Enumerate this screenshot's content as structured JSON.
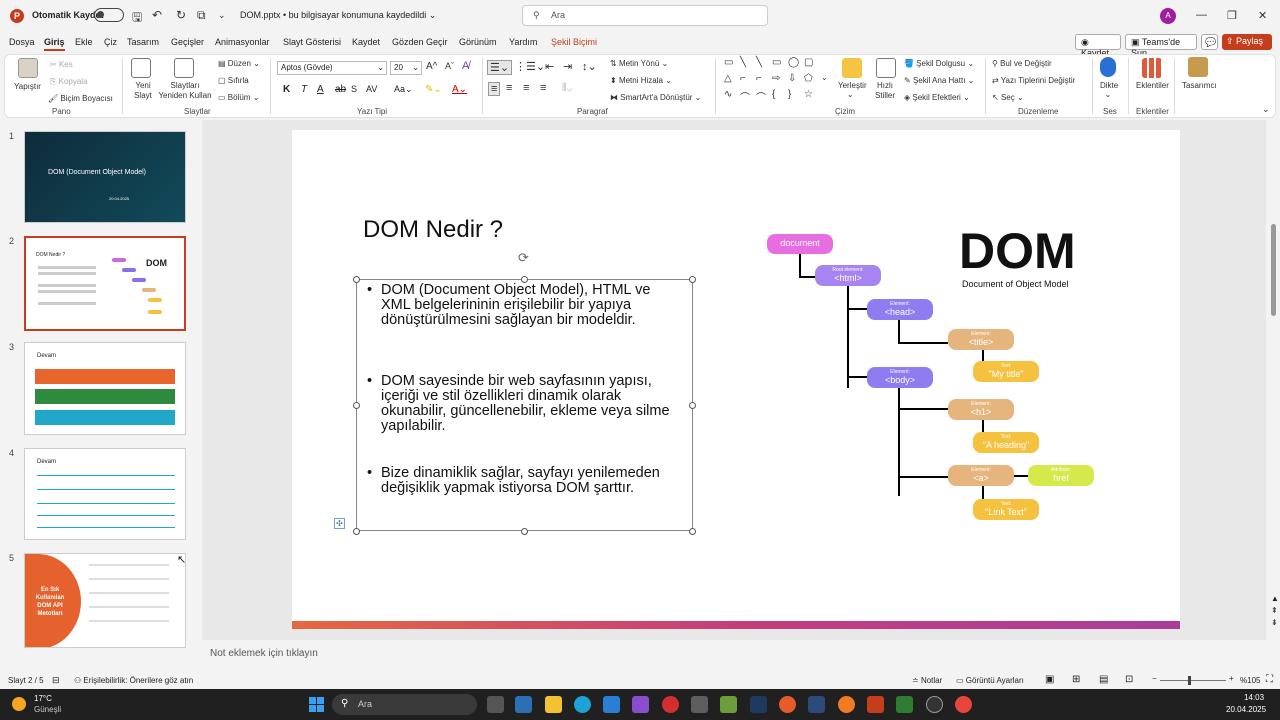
{
  "titlebar": {
    "autosave_label": "Otomatik Kaydet",
    "doc_title": "DOM.pptx • bu bilgisayar konumuna kaydedildi ⌄",
    "search_placeholder": "Ara",
    "avatar": "A",
    "minimize": "—",
    "restore": "❐",
    "close": "✕"
  },
  "menu": {
    "tabs": [
      "Dosya",
      "Giriş",
      "Ekle",
      "Çiz",
      "Tasarım",
      "Geçişler",
      "Animasyonlar",
      "Slayt Gösterisi",
      "Kaydet",
      "Gözden Geçir",
      "Görünüm",
      "Yardım",
      "Şekil Biçimi"
    ],
    "record_btn": "Kaydet",
    "teams_btn": "Teams'de Sun",
    "share_btn": "Paylaş"
  },
  "ribbon": {
    "paste": "Yapıştır",
    "cut": "Kes",
    "copy": "Kopyala",
    "format_painter": "Biçim Boyacısı",
    "group_clipboard": "Pano",
    "new_slide": "Yeni Slayt",
    "reuse_slides": "Slaytları Yeniden Kullan",
    "layout": "Düzen",
    "reset": "Sıfırla",
    "section": "Bölüm",
    "group_slides": "Slaytlar",
    "font_name": "Aptos (Gövde)",
    "font_size": "20",
    "group_font": "Yazı Tipi",
    "text_direction": "Metin Yönü",
    "align_text": "Metni Hizala",
    "smartart": "SmartArt'a Dönüştür",
    "group_paragraph": "Paragraf",
    "arrange": "Yerleştir",
    "quick_styles": "Hızlı Stiller",
    "shape_fill": "Şekil Dolgusu",
    "shape_outline": "Şekil Ana Hattı",
    "shape_effects": "Şekil Efektleri",
    "group_drawing": "Çizim",
    "find_replace": "Bul ve Değiştir",
    "replace_fonts": "Yazı Tiplerini Değiştir",
    "select": "Seç",
    "group_editing": "Düzenleme",
    "dictate": "Dikte",
    "group_voice": "Ses",
    "addins": "Eklentiler",
    "group_addins": "Eklentiler",
    "designer": "Tasarımcı"
  },
  "thumbnails": [
    {
      "num": "1",
      "title": "DOM (Document Object Model)",
      "date": "20.04.2025"
    },
    {
      "num": "2",
      "title": "DOM Nedir ?"
    },
    {
      "num": "3",
      "title": "Devam"
    },
    {
      "num": "4",
      "title": "Devam"
    },
    {
      "num": "5",
      "title": "En Sık Kullanılan DOM API Metotları"
    }
  ],
  "slide": {
    "title": "DOM Nedir ?",
    "bullets": [
      "DOM (Document Object Model), HTML ve XML belgelerininin erişilebilir bir yapıya dönüştürülmesini sağlayan bir modeldir.",
      "DOM sayesinde bir web sayfasının yapısı, içeriği ve stil özellikleri dinamik olarak okunabilir, güncellenebilir, ekleme veya silme yapılabilir.",
      "Bize dinamiklik sağlar, sayfayı yenilemeden değişiklik yapmak istiyorsa DOM şarttır."
    ],
    "diagram": {
      "big_title": "DOM",
      "subtitle": "Document of Object Model",
      "document": "document",
      "root_cap": "Root element:",
      "html": "<html>",
      "el_cap": "Element:",
      "head": "<head>",
      "title": "<title>",
      "text_cap": "Text:",
      "my_title": "\"My title\"",
      "body": "<body>",
      "h1": "<h1>",
      "a_heading": "\"A heading\"",
      "a": "<a>",
      "attr_cap": "Attribute:",
      "href": "href",
      "link_text": "\"Link Text\""
    }
  },
  "notes_placeholder": "Not eklemek için tıklayın",
  "status": {
    "slide_num": "Slayt 2 / 5",
    "accessibility": "Erişilebilirlik: Önerilere göz atın",
    "notes": "Notlar",
    "display_settings": "Görüntü Ayarları",
    "zoom": "%105"
  },
  "taskbar": {
    "weather_temp": "17°C",
    "weather_desc": "Güneşli",
    "search": "Ara",
    "time": "14:03",
    "date": "20.04.2025"
  }
}
